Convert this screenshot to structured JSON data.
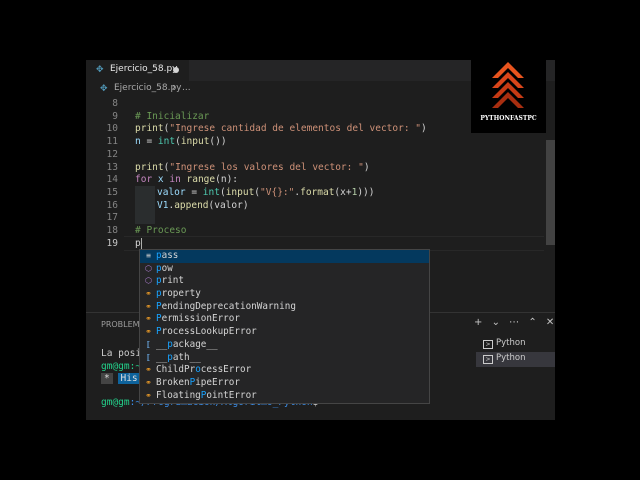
{
  "tab": {
    "filename": "Ejercicio_58.py"
  },
  "breadcrumb": {
    "file": "Ejercicio_58.py",
    "separator": "›",
    "more": "..."
  },
  "editor": {
    "line_numbers": [
      "8",
      "9",
      "10",
      "11",
      "12",
      "13",
      "14",
      "15",
      "16",
      "17",
      "18",
      "19"
    ],
    "lines": {
      "l9": "# Inicializar",
      "l10_fn": "print",
      "l10_open": "(",
      "l10_str": "\"Ingrese cantidad de elementos del vector: \"",
      "l10_close": ")",
      "l11_var": "n",
      "l11_eq": " = ",
      "l11_fn1": "int",
      "l11_mid": "(",
      "l11_fn2": "input",
      "l11_end": "())",
      "l13_fn": "print",
      "l13_open": "(",
      "l13_str": "\"Ingrese los valores del vector: \"",
      "l13_close": ")",
      "l14_kw1": "for",
      "l14_var": " x ",
      "l14_kw2": "in",
      "l14_fn": " range",
      "l14_end": "(n):",
      "l15_var": "valor",
      "l15_eq": " = ",
      "l15_fn1": "int",
      "l15_p1": "(",
      "l15_fn2": "input",
      "l15_p2": "(",
      "l15_str": "\"V{}:\"",
      "l15_dot": ".",
      "l15_fn3": "format",
      "l15_p3": "(x+",
      "l15_num": "1",
      "l15_end": ")))",
      "l16_var": "V1",
      "l16_dot": ".",
      "l16_fn": "append",
      "l16_end": "(valor)",
      "l18": "# Proceso",
      "l19": "p"
    }
  },
  "suggestions": [
    {
      "pre": "",
      "match": "p",
      "post": "ass",
      "kind": "keyword"
    },
    {
      "pre": "",
      "match": "p",
      "post": "ow",
      "kind": "function"
    },
    {
      "pre": "",
      "match": "p",
      "post": "rint",
      "kind": "function"
    },
    {
      "pre": "",
      "match": "p",
      "post": "roperty",
      "kind": "class"
    },
    {
      "pre": "",
      "match": "P",
      "post": "endingDeprecationWarning",
      "kind": "class"
    },
    {
      "pre": "",
      "match": "P",
      "post": "ermissionError",
      "kind": "class"
    },
    {
      "pre": "",
      "match": "P",
      "post": "rocessLookupError",
      "kind": "class"
    },
    {
      "pre": "__",
      "match": "p",
      "post": "ackage__",
      "kind": "variable"
    },
    {
      "pre": "__",
      "match": "p",
      "post": "ath__",
      "kind": "variable"
    },
    {
      "pre": "ChildPr",
      "match": "o",
      "post": "cessError",
      "kind": "class"
    },
    {
      "pre": "Broken",
      "match": "P",
      "post": "ipeError",
      "kind": "class"
    },
    {
      "pre": "Floating",
      "match": "P",
      "post": "ointError",
      "kind": "class"
    }
  ],
  "panel": {
    "tab_label": "PROBLEMA",
    "icons": [
      "+",
      "⌄",
      "⋯",
      "⌃",
      "✕"
    ],
    "terminal_line1": "La posi",
    "terminal_prompt1": "gm@gm:~",
    "terminal_hint_star": "*",
    "terminal_hint_text": "His",
    "terminal_prompt2_user": "gm@gm",
    "terminal_prompt2_path": ":~/Programacion/Algoritmo_Python",
    "terminal_prompt2_end": "$",
    "terminals": [
      "Python",
      "Python"
    ]
  },
  "logo": {
    "text": "PYTHONFASTPC"
  }
}
